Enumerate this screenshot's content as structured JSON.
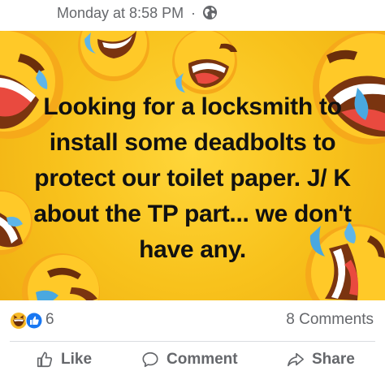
{
  "post": {
    "timestamp": "Monday at 8:58 PM",
    "separator": "·",
    "privacy_icon": "globe-icon",
    "text": "Looking for a locksmith to install some deadbolts to protect our toilet paper. J/ K about the TP part... we don't have any.",
    "background_color": "#f8c21c"
  },
  "reactions": {
    "icons": [
      "haha-icon",
      "like-icon"
    ],
    "count": "6",
    "comments": "8 Comments"
  },
  "actions": {
    "like": "Like",
    "comment": "Comment",
    "share": "Share"
  }
}
